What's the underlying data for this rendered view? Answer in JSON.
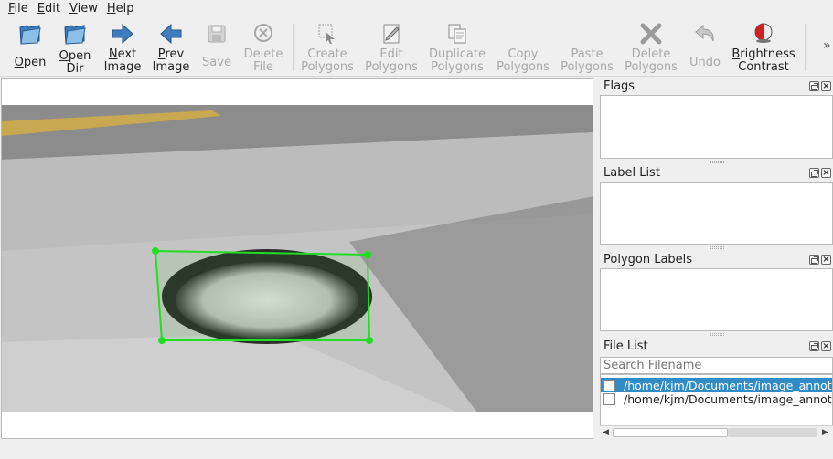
{
  "menu": [
    {
      "u": "F",
      "rest": "ile"
    },
    {
      "u": "E",
      "rest": "dit"
    },
    {
      "u": "V",
      "rest": "iew"
    },
    {
      "u": "H",
      "rest": "elp"
    }
  ],
  "toolbar": {
    "open": {
      "u": "O",
      "rest": "pen"
    },
    "open_dir_1": {
      "u": "O",
      "rest": "pen"
    },
    "open_dir_2": "Dir",
    "next_1": {
      "u": "N",
      "rest": "ext"
    },
    "next_2": "Image",
    "prev_1": {
      "u": "P",
      "rest": "rev"
    },
    "prev_2": "Image",
    "save": "Save",
    "delete_file_1": "Delete",
    "delete_file_2": "File",
    "create_1": "Create",
    "create_2": "Polygons",
    "edit_1": "Edit",
    "edit_2": "Polygons",
    "duplicate_1": "Duplicate",
    "duplicate_2": "Polygons",
    "copy_1": "Copy",
    "copy_2": "Polygons",
    "paste_1": "Paste",
    "paste_2": "Polygons",
    "delete_1": "Delete",
    "delete_2": "Polygons",
    "undo": "Undo",
    "brightness_1": {
      "u": "B",
      "rest": "rightness"
    },
    "brightness_2": "Contrast",
    "extension": "»"
  },
  "docks": {
    "flags": "Flags",
    "label_list": "Label List",
    "polygon_labels": "Polygon Labels",
    "file_list": "File List"
  },
  "file_list": {
    "search_placeholder": "Search Filename",
    "files": [
      "/home/kjm/Documents/image_annotation/",
      "/home/kjm/Documents/image_annotation/"
    ]
  },
  "annotation": {
    "shape_color": "#22dd22",
    "selected_row_color": "#308cc6"
  }
}
